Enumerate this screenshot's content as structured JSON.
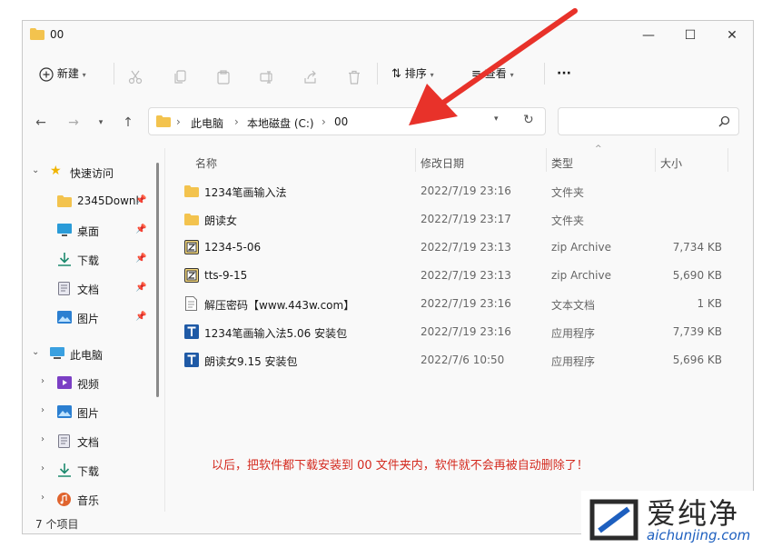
{
  "window": {
    "title": "00"
  },
  "titlebar": {
    "minimize": "—",
    "maximize": "☐",
    "close": "✕"
  },
  "toolbar": {
    "new_label": "新建",
    "sort_label": "排序",
    "view_label": "查看",
    "more_label": "···"
  },
  "address": {
    "crumbs": [
      "此电脑",
      "本地磁盘 (C:)",
      "00"
    ],
    "separator": "›"
  },
  "search": {
    "placeholder": ""
  },
  "sidebar": {
    "quick_access": "快速访问",
    "quick_items": [
      {
        "label": "2345Downl",
        "icon": "folder-icon"
      },
      {
        "label": "桌面",
        "icon": "desktop-icon"
      },
      {
        "label": "下载",
        "icon": "download-icon"
      },
      {
        "label": "文档",
        "icon": "document-icon"
      },
      {
        "label": "图片",
        "icon": "picture-icon"
      }
    ],
    "this_pc": "此电脑",
    "pc_items": [
      {
        "label": "视频",
        "icon": "video-icon"
      },
      {
        "label": "图片",
        "icon": "picture-icon"
      },
      {
        "label": "文档",
        "icon": "document-icon"
      },
      {
        "label": "下载",
        "icon": "download-icon"
      },
      {
        "label": "音乐",
        "icon": "music-icon"
      }
    ]
  },
  "table": {
    "headers": {
      "name": "名称",
      "date": "修改日期",
      "type": "类型",
      "size": "大小"
    },
    "rows": [
      {
        "icon": "folder-icon",
        "name": "1234笔画输入法",
        "date": "2022/7/19 23:16",
        "type": "文件夹",
        "size": ""
      },
      {
        "icon": "folder-icon",
        "name": "朗读女",
        "date": "2022/7/19 23:17",
        "type": "文件夹",
        "size": ""
      },
      {
        "icon": "zip-icon",
        "name": "1234-5-06",
        "date": "2022/7/19 23:13",
        "type": "zip Archive",
        "size": "7,734 KB"
      },
      {
        "icon": "zip-icon",
        "name": "tts-9-15",
        "date": "2022/7/19 23:13",
        "type": "zip Archive",
        "size": "5,690 KB"
      },
      {
        "icon": "text-file-icon",
        "name": "解压密码【www.443w.com】",
        "date": "2022/7/19 23:16",
        "type": "文本文档",
        "size": "1 KB"
      },
      {
        "icon": "app-icon",
        "name": "1234笔画输入法5.06 安装包",
        "date": "2022/7/19 23:16",
        "type": "应用程序",
        "size": "7,739 KB"
      },
      {
        "icon": "app-icon",
        "name": "朗读女9.15 安装包",
        "date": "2022/7/6 10:50",
        "type": "应用程序",
        "size": "5,696 KB"
      }
    ]
  },
  "annotation": {
    "text": "以后，把软件都下载安装到 00 文件夹内，软件就不会再被自动删除了！"
  },
  "status": {
    "count": "7 个项目"
  },
  "watermark": {
    "brand": "爱纯净",
    "url": "aichunjing.com"
  },
  "colors": {
    "folder": "#f3c34e",
    "accent_blue": "#1f5aa6",
    "annotation": "#d42a1f",
    "arrow": "#e8322a"
  }
}
